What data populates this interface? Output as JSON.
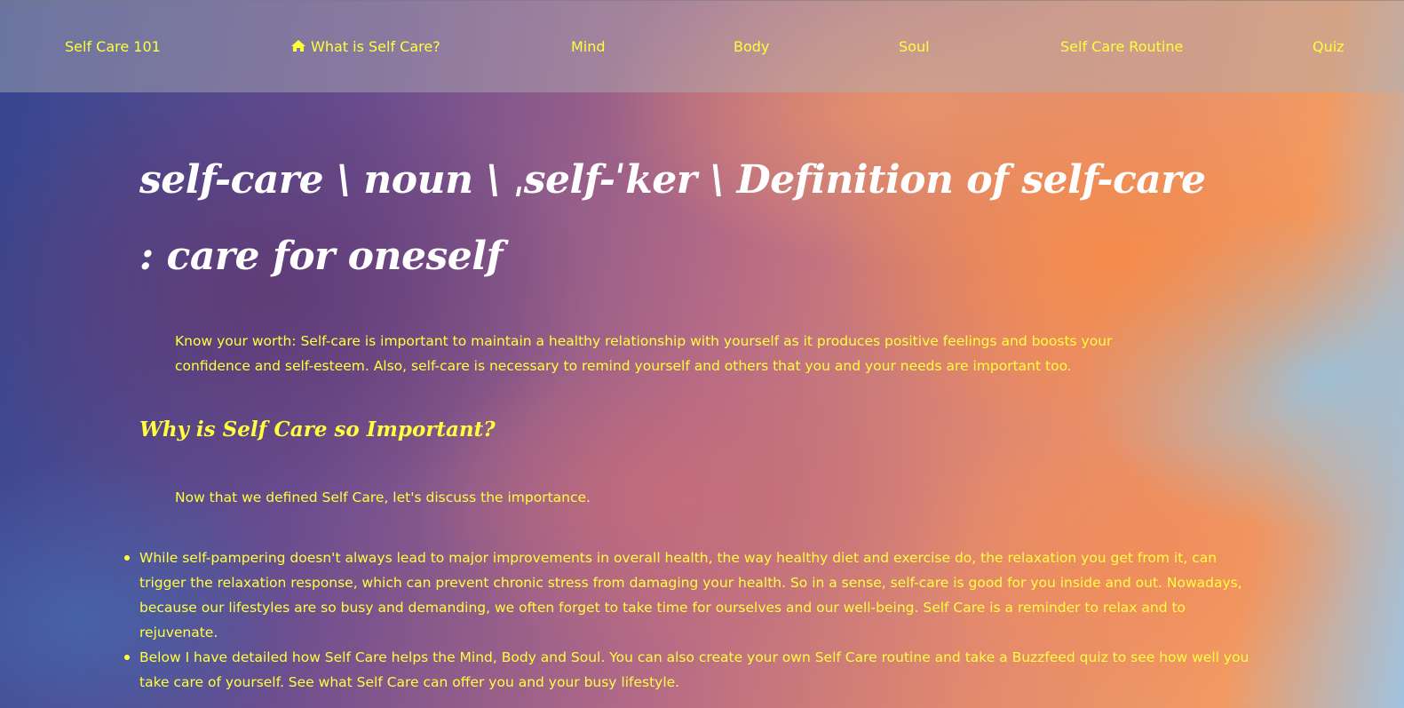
{
  "nav": {
    "brand": "Self Care 101",
    "home_label": "What is Self Care?",
    "home_icon": "home-icon",
    "items": [
      "Mind",
      "Body",
      "Soul",
      "Self Care Routine",
      "Quiz"
    ],
    "link_color": "#ffff3c"
  },
  "main": {
    "title": "self-care \\ noun \\ ˌself-ˈker \\ Definition of self-care : care for oneself",
    "intro": "Know your worth: Self-care is important to maintain a healthy relationship with yourself as it produces positive feelings and boosts your confidence and self-esteem. Also, self-care is necessary to remind yourself and others that you and your needs are important too.",
    "subheading": "Why is Self Care so Important?",
    "lead": "Now that we defined Self Care, let's discuss the importance.",
    "bullets": [
      "While self-pampering doesn't always lead to major improvements in overall health, the way healthy diet and exercise do, the relaxation you get from it, can trigger the relaxation response, which can prevent chronic stress from damaging your health. So in a sense, self-care is good for you inside and out. Nowadays, because our lifestyles are so busy and demanding, we often forget to take time for ourselves and our well-being. Self Care is a reminder to relax and to rejuvenate.",
      "Below I have detailed how Self Care helps the Mind, Body and Soul. You can also create your own Self Care routine and take a Buzzfeed quiz to see how well you take care of yourself. See what Self Care can offer you and your busy lifestyle."
    ]
  }
}
